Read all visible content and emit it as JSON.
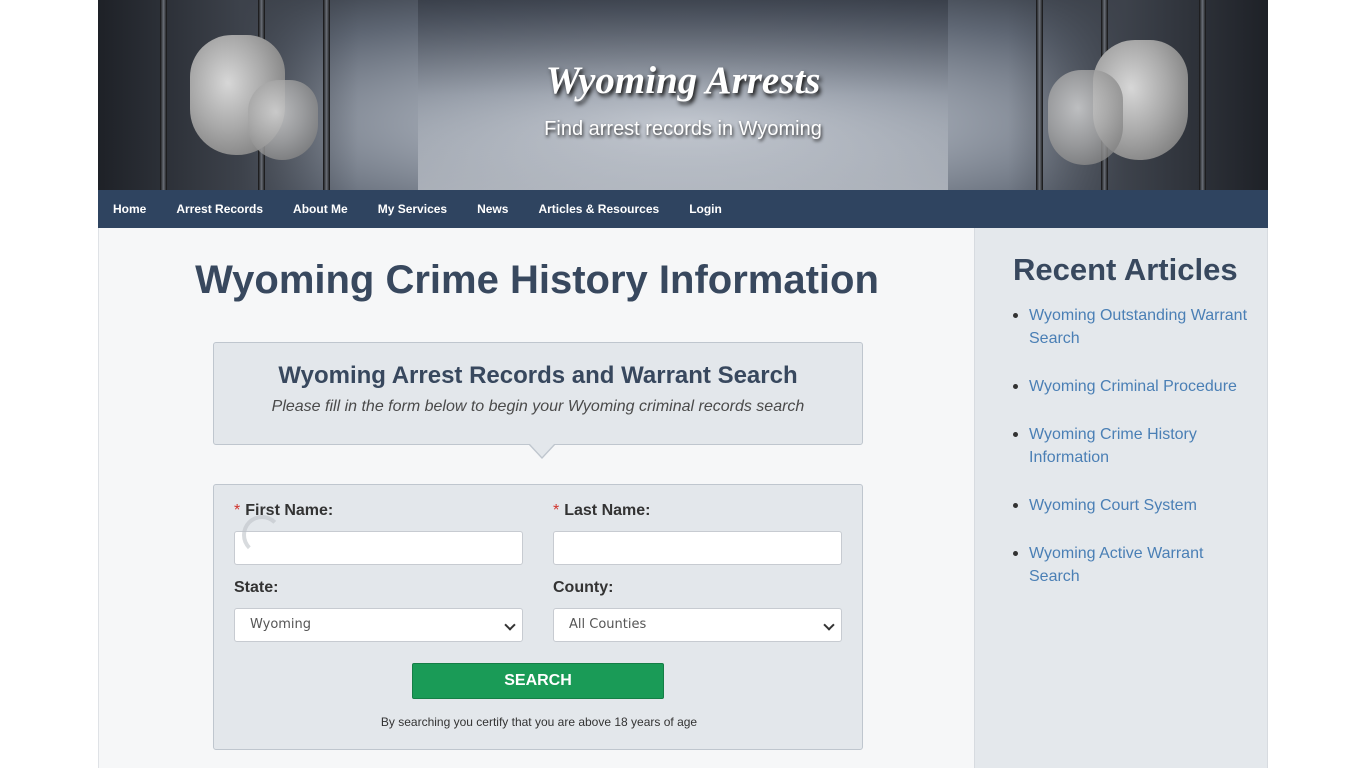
{
  "header": {
    "title": "Wyoming Arrests",
    "subtitle": "Find arrest records in Wyoming"
  },
  "nav": {
    "items": [
      {
        "label": "Home"
      },
      {
        "label": "Arrest Records"
      },
      {
        "label": "About Me"
      },
      {
        "label": "My Services"
      },
      {
        "label": "News"
      },
      {
        "label": "Articles & Resources"
      },
      {
        "label": "Login"
      }
    ]
  },
  "main": {
    "title": "Wyoming Crime History Information",
    "search_header": {
      "title": "Wyoming Arrest Records and Warrant Search",
      "subtitle": "Please fill in the form below to begin your Wyoming criminal records search"
    },
    "form": {
      "required_marker": "*",
      "first_name_label": "First Name:",
      "first_name_value": "",
      "last_name_label": "Last Name:",
      "last_name_value": "",
      "state_label": "State:",
      "state_value": "Wyoming",
      "county_label": "County:",
      "county_value": "All Counties",
      "search_button": "SEARCH",
      "certify_text": "By searching you certify that you are above 18 years of age"
    }
  },
  "sidebar": {
    "title": "Recent Articles",
    "articles": [
      {
        "label": "Wyoming Outstanding Warrant Search"
      },
      {
        "label": "Wyoming Criminal Procedure"
      },
      {
        "label": "Wyoming Crime History Information"
      },
      {
        "label": "Wyoming Court System"
      },
      {
        "label": "Wyoming Active Warrant Search"
      }
    ]
  },
  "colors": {
    "nav_bg": "#2f4460",
    "heading": "#38485e",
    "link": "#4a7fb5",
    "button": "#1a9b57",
    "required": "#d0342c"
  }
}
